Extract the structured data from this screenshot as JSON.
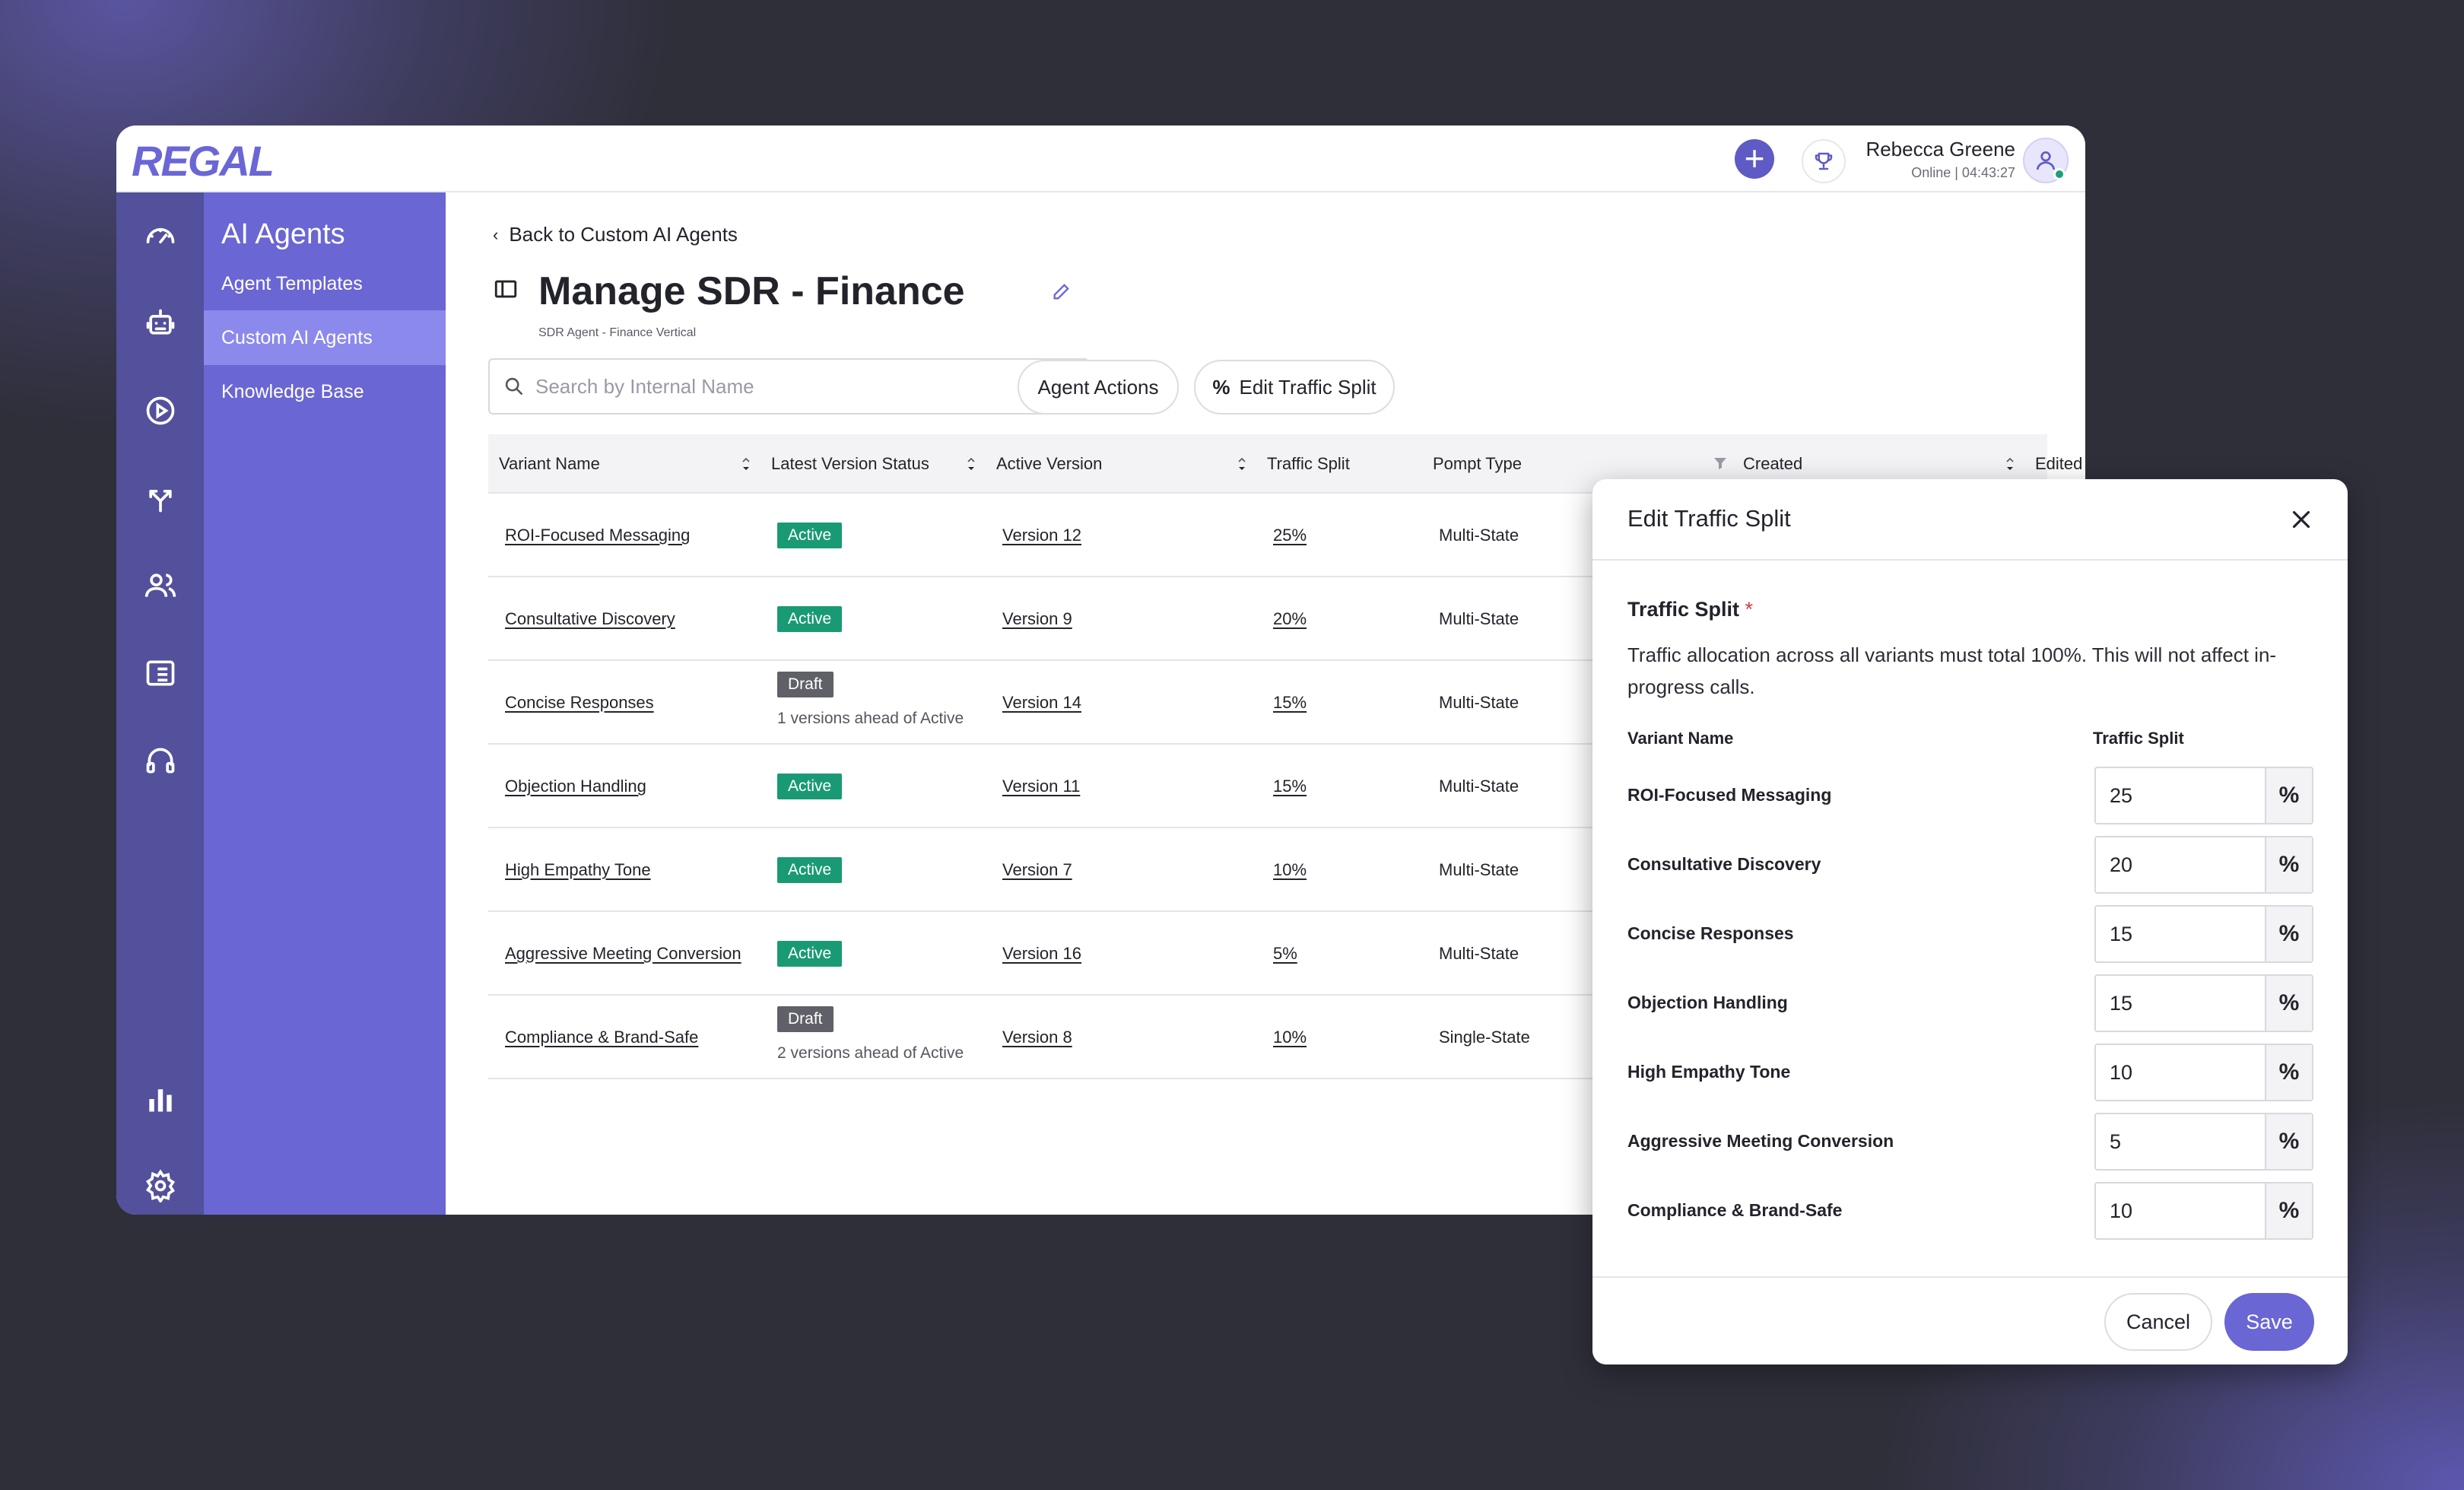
{
  "brand": {
    "logo_text": "REGAL",
    "accent": "#6a66d4",
    "rail_bg": "#53509c"
  },
  "topbar": {
    "user_name": "Rebecca Greene",
    "user_status": "Online | 04:43:27",
    "icons": [
      "plus-icon",
      "trophy-icon",
      "user-avatar-icon"
    ]
  },
  "rail": {
    "icons": [
      "dashboard-icon",
      "robot-icon",
      "play-icon",
      "routing-icon",
      "users-icon",
      "list-card-icon",
      "headset-icon",
      "bar-chart-icon",
      "gear-icon"
    ]
  },
  "subnav": {
    "title": "AI Agents",
    "items": [
      {
        "label": "Agent Templates",
        "active": false
      },
      {
        "label": "Custom AI Agents",
        "active": true
      },
      {
        "label": "Knowledge Base",
        "active": false
      }
    ]
  },
  "page": {
    "back_label": "Back to Custom AI Agents",
    "title": "Manage SDR - Finance",
    "subtitle": "SDR Agent - Finance Vertical",
    "search_placeholder": "Search by Internal Name",
    "agent_actions_label": "Agent Actions",
    "edit_traffic_label": "Edit Traffic Split"
  },
  "table": {
    "headers": [
      "Variant Name",
      "Latest Version Status",
      "Active Version",
      "Traffic Split",
      "Pompt Type",
      "Created",
      "Edited"
    ],
    "rows": [
      {
        "name": "ROI-Focused Messaging",
        "status": "Active",
        "ahead": "",
        "version": "Version 12",
        "split": "25%",
        "type": "Multi-State"
      },
      {
        "name": "Consultative Discovery",
        "status": "Active",
        "ahead": "",
        "version": "Version 9",
        "split": "20%",
        "type": "Multi-State"
      },
      {
        "name": "Concise Responses",
        "status": "Draft",
        "ahead": "1 versions ahead of Active",
        "version": "Version 14",
        "split": "15%",
        "type": "Multi-State"
      },
      {
        "name": "Objection Handling",
        "status": "Active",
        "ahead": "",
        "version": "Version 11",
        "split": "15%",
        "type": "Multi-State"
      },
      {
        "name": "High Empathy Tone",
        "status": "Active",
        "ahead": "",
        "version": "Version 7",
        "split": "10%",
        "type": "Multi-State"
      },
      {
        "name": "Aggressive Meeting Conversion",
        "status": "Active",
        "ahead": "",
        "version": "Version 16",
        "split": "5%",
        "type": "Multi-State"
      },
      {
        "name": "Compliance & Brand-Safe",
        "status": "Draft",
        "ahead": "2 versions ahead of Active",
        "version": "Version 8",
        "split": "10%",
        "type": "Single-State"
      }
    ]
  },
  "modal": {
    "title": "Edit Traffic Split",
    "field_label": "Traffic Split",
    "required_mark": "*",
    "help": "Traffic allocation across all variants must total 100%. This will not affect in-progress calls.",
    "col_variant": "Variant Name",
    "col_split": "Traffic Split",
    "pct_symbol": "%",
    "rows": [
      {
        "name": "ROI-Focused Messaging",
        "value": "25"
      },
      {
        "name": "Consultative Discovery",
        "value": "20"
      },
      {
        "name": "Concise Responses",
        "value": "15"
      },
      {
        "name": "Objection Handling",
        "value": "15"
      },
      {
        "name": "High Empathy Tone",
        "value": "10"
      },
      {
        "name": "Aggressive Meeting Conversion",
        "value": "5"
      },
      {
        "name": "Compliance & Brand-Safe",
        "value": "10"
      }
    ],
    "cancel_label": "Cancel",
    "save_label": "Save"
  }
}
